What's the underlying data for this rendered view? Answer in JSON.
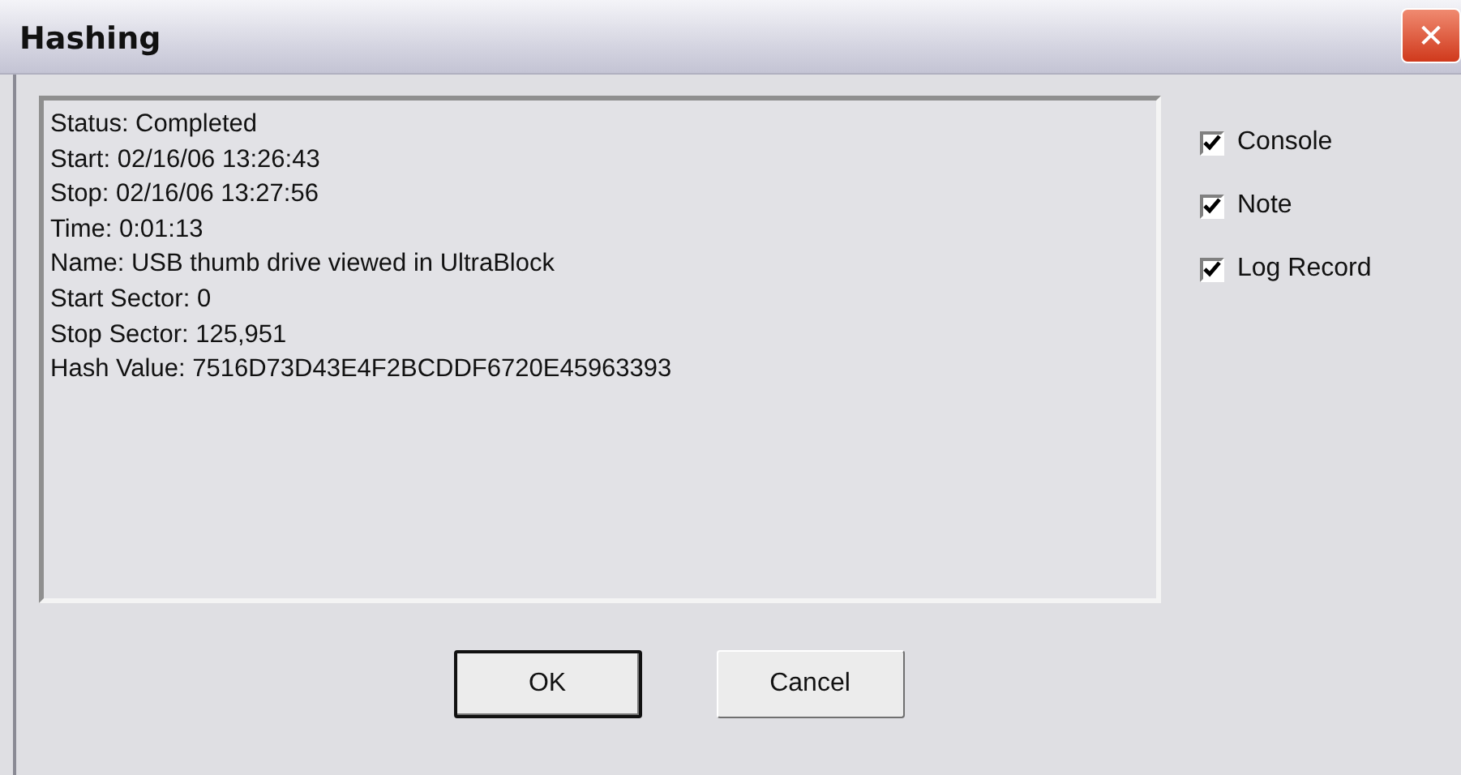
{
  "window": {
    "title": "Hashing",
    "close": "✕"
  },
  "details": [
    "Status: Completed",
    "Start: 02/16/06 13:26:43",
    "Stop: 02/16/06 13:27:56",
    "Time: 0:01:13",
    "Name: USB thumb drive viewed in UltraBlock",
    "Start Sector: 0",
    "Stop Sector: 125,951",
    "Hash Value: 7516D73D43E4F2BCDDF6720E45963393"
  ],
  "options": [
    {
      "label": "Console",
      "checked": true
    },
    {
      "label": "Note",
      "checked": true
    },
    {
      "label": "Log Record",
      "checked": true
    }
  ],
  "buttons": [
    {
      "label": "OK",
      "default": true
    },
    {
      "label": "Cancel",
      "default": false
    }
  ]
}
